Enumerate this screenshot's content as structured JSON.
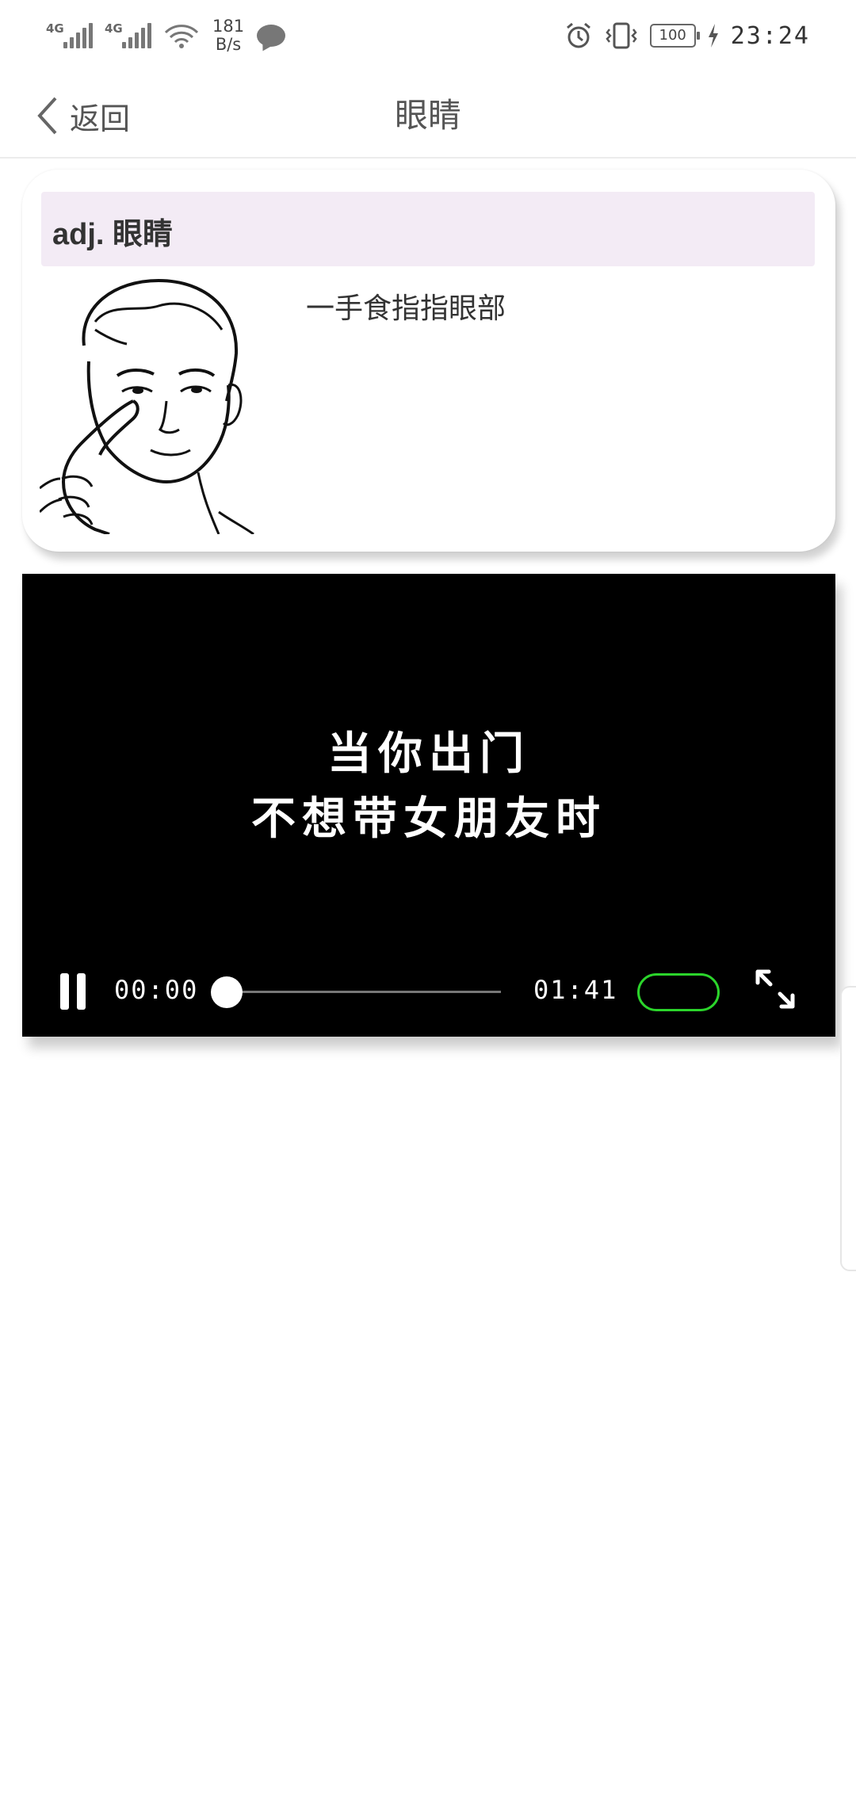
{
  "status_bar": {
    "network1": "4G",
    "network2": "4G",
    "speed_value": "181",
    "speed_unit": "B/s",
    "battery": "100",
    "time": "23:24",
    "icons": [
      "signal-icon",
      "wifi-icon",
      "chat-icon",
      "alarm-icon",
      "vibrate-icon",
      "battery-icon",
      "charging-icon"
    ]
  },
  "nav": {
    "back_label": "返回",
    "title": "眼睛"
  },
  "card": {
    "header": "adj. 眼睛",
    "description": "一手食指指眼部"
  },
  "video": {
    "caption_line1": "当你出门",
    "caption_line2": "不想带女朋友时",
    "current_time": "00:00",
    "total_time": "01:41",
    "progress": 0,
    "accent_color": "#2bd42b"
  }
}
